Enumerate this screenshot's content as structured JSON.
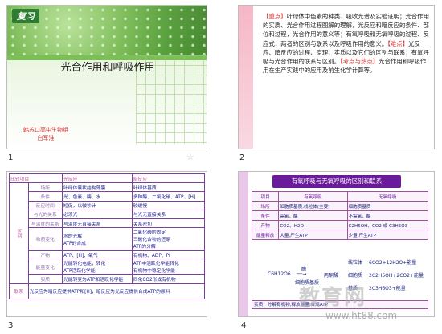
{
  "slides": [
    {
      "number": "1",
      "tag": "复习",
      "title": "光合作用和呼吸作用",
      "author_line1": "韩苏口高中生物组",
      "author_line2": "白军淮"
    },
    {
      "number": "2",
      "segments": [
        {
          "text": "【重点】",
          "hl": true
        },
        {
          "text": "叶绿体中色素的种类、吸收光谱及实验证明；光合作用的实质、光合作用过程图解的理解，光反应和暗反应的条件、部位和过程，光合作用的意义等；有氧呼吸和无氧呼吸的过程、反应式，两者的区别与联系以及呼吸作用的意义。",
          "hl": false
        },
        {
          "text": "【难点】",
          "hl": true
        },
        {
          "text": "光反应、暗反应的过程、原理、实质以及它们的区别与联系；有氧呼吸与光合作用的联系与区别。",
          "hl": false
        },
        {
          "text": "【考点与热点】",
          "hl": true
        },
        {
          "text": "光合作用和呼吸作用在生产实践中的应用及前生化学计算等。",
          "hl": false
        }
      ]
    },
    {
      "number": "3",
      "header": [
        "比较项目",
        "光反应",
        "暗反应"
      ],
      "rows": [
        {
          "label": "场所",
          "light": "叶绿体囊状结构薄膜",
          "dark": "叶绿体基质"
        },
        {
          "label": "条件",
          "light": "光、色素、酶、水",
          "dark": "多种酶、二氧化碳、ATP、[H]"
        },
        {
          "label": "反应时间",
          "light": "短促，以微秒计",
          "dark": "较缓慢"
        },
        {
          "label": "与光的关系",
          "light": "必须光",
          "dark": "与光无直接关系"
        },
        {
          "label": "与温度的关系",
          "light": "与温度无直接关系",
          "dark": "关系密切"
        },
        {
          "label": "物质变化",
          "light": "水的光解\nATP的合成",
          "dark": "二氧化碳的固定\n三碳化合物的还原\nATP的分解"
        },
        {
          "label": "产物",
          "light": "ATP、[H]、氧气",
          "dark": "有机物、ADP、Pi"
        },
        {
          "label": "能量变化",
          "light": "光能转化电能，转化\nATP活跃化学能",
          "dark": "ATP中活跃化学能转化\n有机物中稳定化学能"
        },
        {
          "label": "实质",
          "light": "光能转变为ATP和活跃化学能",
          "dark": "同化CO2形成有机物"
        }
      ],
      "side_label": "区别",
      "relation_label": "联系",
      "relation": "光反应为暗反应提供ATP和[H]，暗反应为光反应提供合成ATP的原料"
    },
    {
      "number": "4",
      "title": "有氧呼吸与无氧呼吸的区别和联系",
      "header": [
        "项目",
        "有氧呼吸",
        "无氧呼吸"
      ],
      "rows": [
        {
          "label": "场所",
          "aerobic": "细胞质基质,线粒体(主要)",
          "anaerobic": "细胞质基质"
        },
        {
          "label": "条件",
          "aerobic": "需氧，酶",
          "anaerobic": "不需氧，酶"
        },
        {
          "label": "产物",
          "aerobic": "CO2、H2O",
          "anaerobic": "C2H5OH、CO2 或 C3H6O3"
        },
        {
          "label": "能量释放",
          "aerobic": "大量,产生ATP",
          "anaerobic": "少量,产生ATP"
        }
      ],
      "reaction": {
        "reactant": "C6H12O6",
        "enzyme": "酶",
        "step1": "丙酮酸",
        "place1": "细胞质基质",
        "branch_top": "6CO2+12H2O+能量",
        "branch_mid": "2C2H5OH+2CO2+能量",
        "branch_bot": "2C3H6O3+能量",
        "label_top": "线粒体",
        "label_mid": "细胞质",
        "label_bot": "基质"
      },
      "footer": "实质：分解有机物,释放能量,合成ATP"
    }
  ],
  "watermark": "教育网",
  "watermark_url": "www.ht88.com"
}
